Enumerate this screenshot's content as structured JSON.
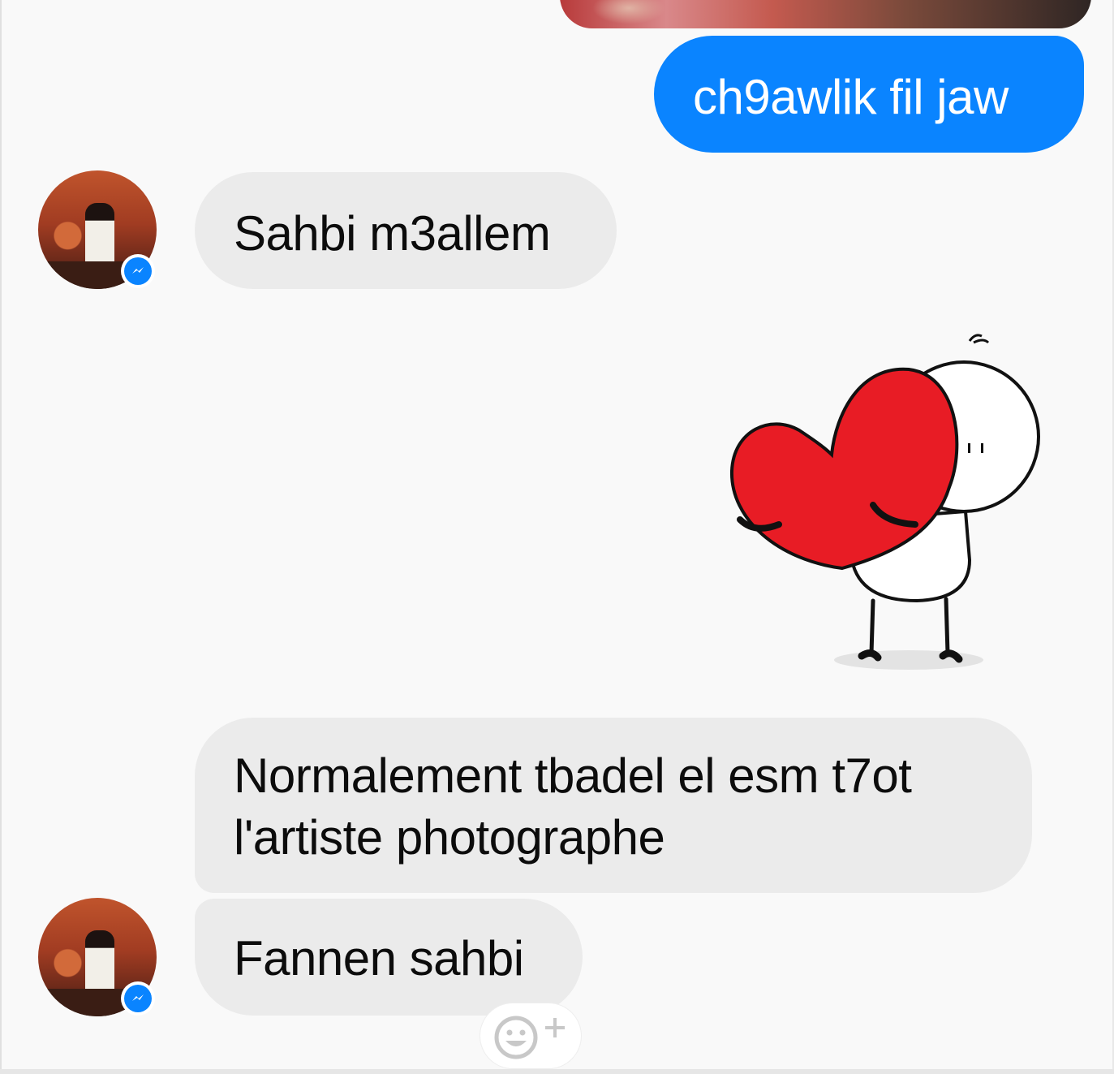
{
  "messages": [
    {
      "direction": "sent",
      "text": "ch9awlik fil jaw"
    },
    {
      "direction": "received",
      "text": "Sahbi m3allem"
    },
    {
      "direction": "received",
      "type": "sticker",
      "sticker": "heart-hug-sticker"
    },
    {
      "direction": "received",
      "lines": [
        "Normalement tbadel el esm t7ot",
        "l'artiste photographe"
      ]
    },
    {
      "direction": "received",
      "text": "Fannen sahbi"
    }
  ],
  "icons": {
    "badge": "messenger-badge-icon",
    "reaction": "add-reaction-icon"
  },
  "colors": {
    "sent_bubble": "#0a84ff",
    "received_bubble": "#ebebeb",
    "background": "#f9f9f9",
    "heart": "#e81c25"
  }
}
